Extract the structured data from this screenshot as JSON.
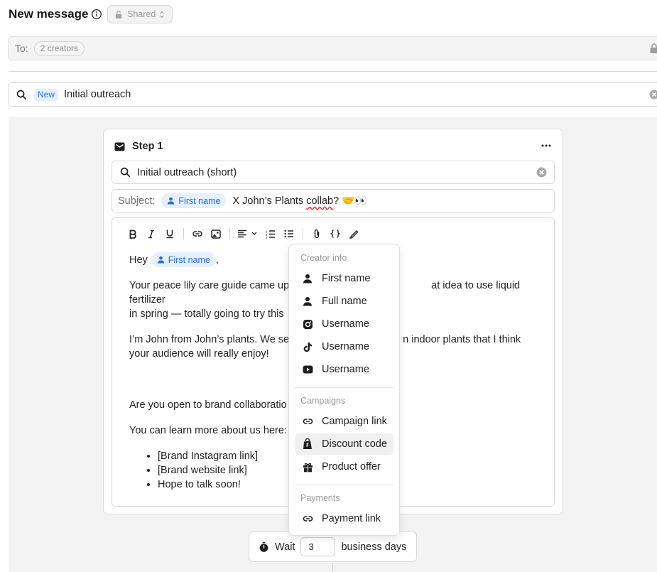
{
  "header": {
    "title": "New message",
    "visibility": "Shared"
  },
  "recipients": {
    "label": "To:",
    "chip": "2 creators"
  },
  "template_search": {
    "badge": "New",
    "value": "Initial outreach"
  },
  "step": {
    "title": "Step 1",
    "template_value": "Initial outreach (short)",
    "subject": {
      "label": "Subject:",
      "variable": "First name",
      "text_before": " X John’s Plants ",
      "misspelled": "collab",
      "text_after": "? 🤝👀"
    },
    "body": {
      "greeting": "Hey",
      "greeting_variable": "First name",
      "greeting_after": ",",
      "p1": "Your peace lily care guide came up — great idea to use liquid fertilizer in spring — totally going to try this.",
      "p1_visible": "Your peace lily care guide came up",
      "p1_tail": "at idea to use liquid fertilizer",
      "p1_line2": "in spring — totally going to try this",
      "p2_line1": "I’m John from John’s plants. We se",
      "p2_tail": "n indoor plants that I think",
      "p2_line2": "your audience will really enjoy!",
      "p3": "Are you open to brand collaboratio",
      "p4": "You can learn more about us here:",
      "list": [
        "[Brand Instagram link]",
        "[Brand website link]",
        "Hope to talk soon!"
      ]
    }
  },
  "wait": {
    "label": "Wait",
    "value": "3",
    "unit": "business days"
  },
  "variable_menu": {
    "sections": [
      {
        "title": "Creator info",
        "items": [
          {
            "label": "First name",
            "icon": "person-icon"
          },
          {
            "label": "Full name",
            "icon": "person-icon"
          },
          {
            "label": "Username",
            "icon": "instagram-icon"
          },
          {
            "label": "Username",
            "icon": "tiktok-icon"
          },
          {
            "label": "Username",
            "icon": "youtube-icon"
          }
        ]
      },
      {
        "title": "Campaigns",
        "items": [
          {
            "label": "Campaign link",
            "icon": "link-icon"
          },
          {
            "label": "Discount code",
            "icon": "shopify-icon"
          },
          {
            "label": "Product offer",
            "icon": "gift-icon"
          }
        ]
      },
      {
        "title": "Payments",
        "items": [
          {
            "label": "Payment link",
            "icon": "link-icon"
          }
        ]
      }
    ]
  },
  "colors": {
    "accent": "#2d6bd0",
    "chip_bg": "#e4efff",
    "canvas_bg": "#f3f3f3",
    "misspell_underline": "#e03a3a"
  }
}
